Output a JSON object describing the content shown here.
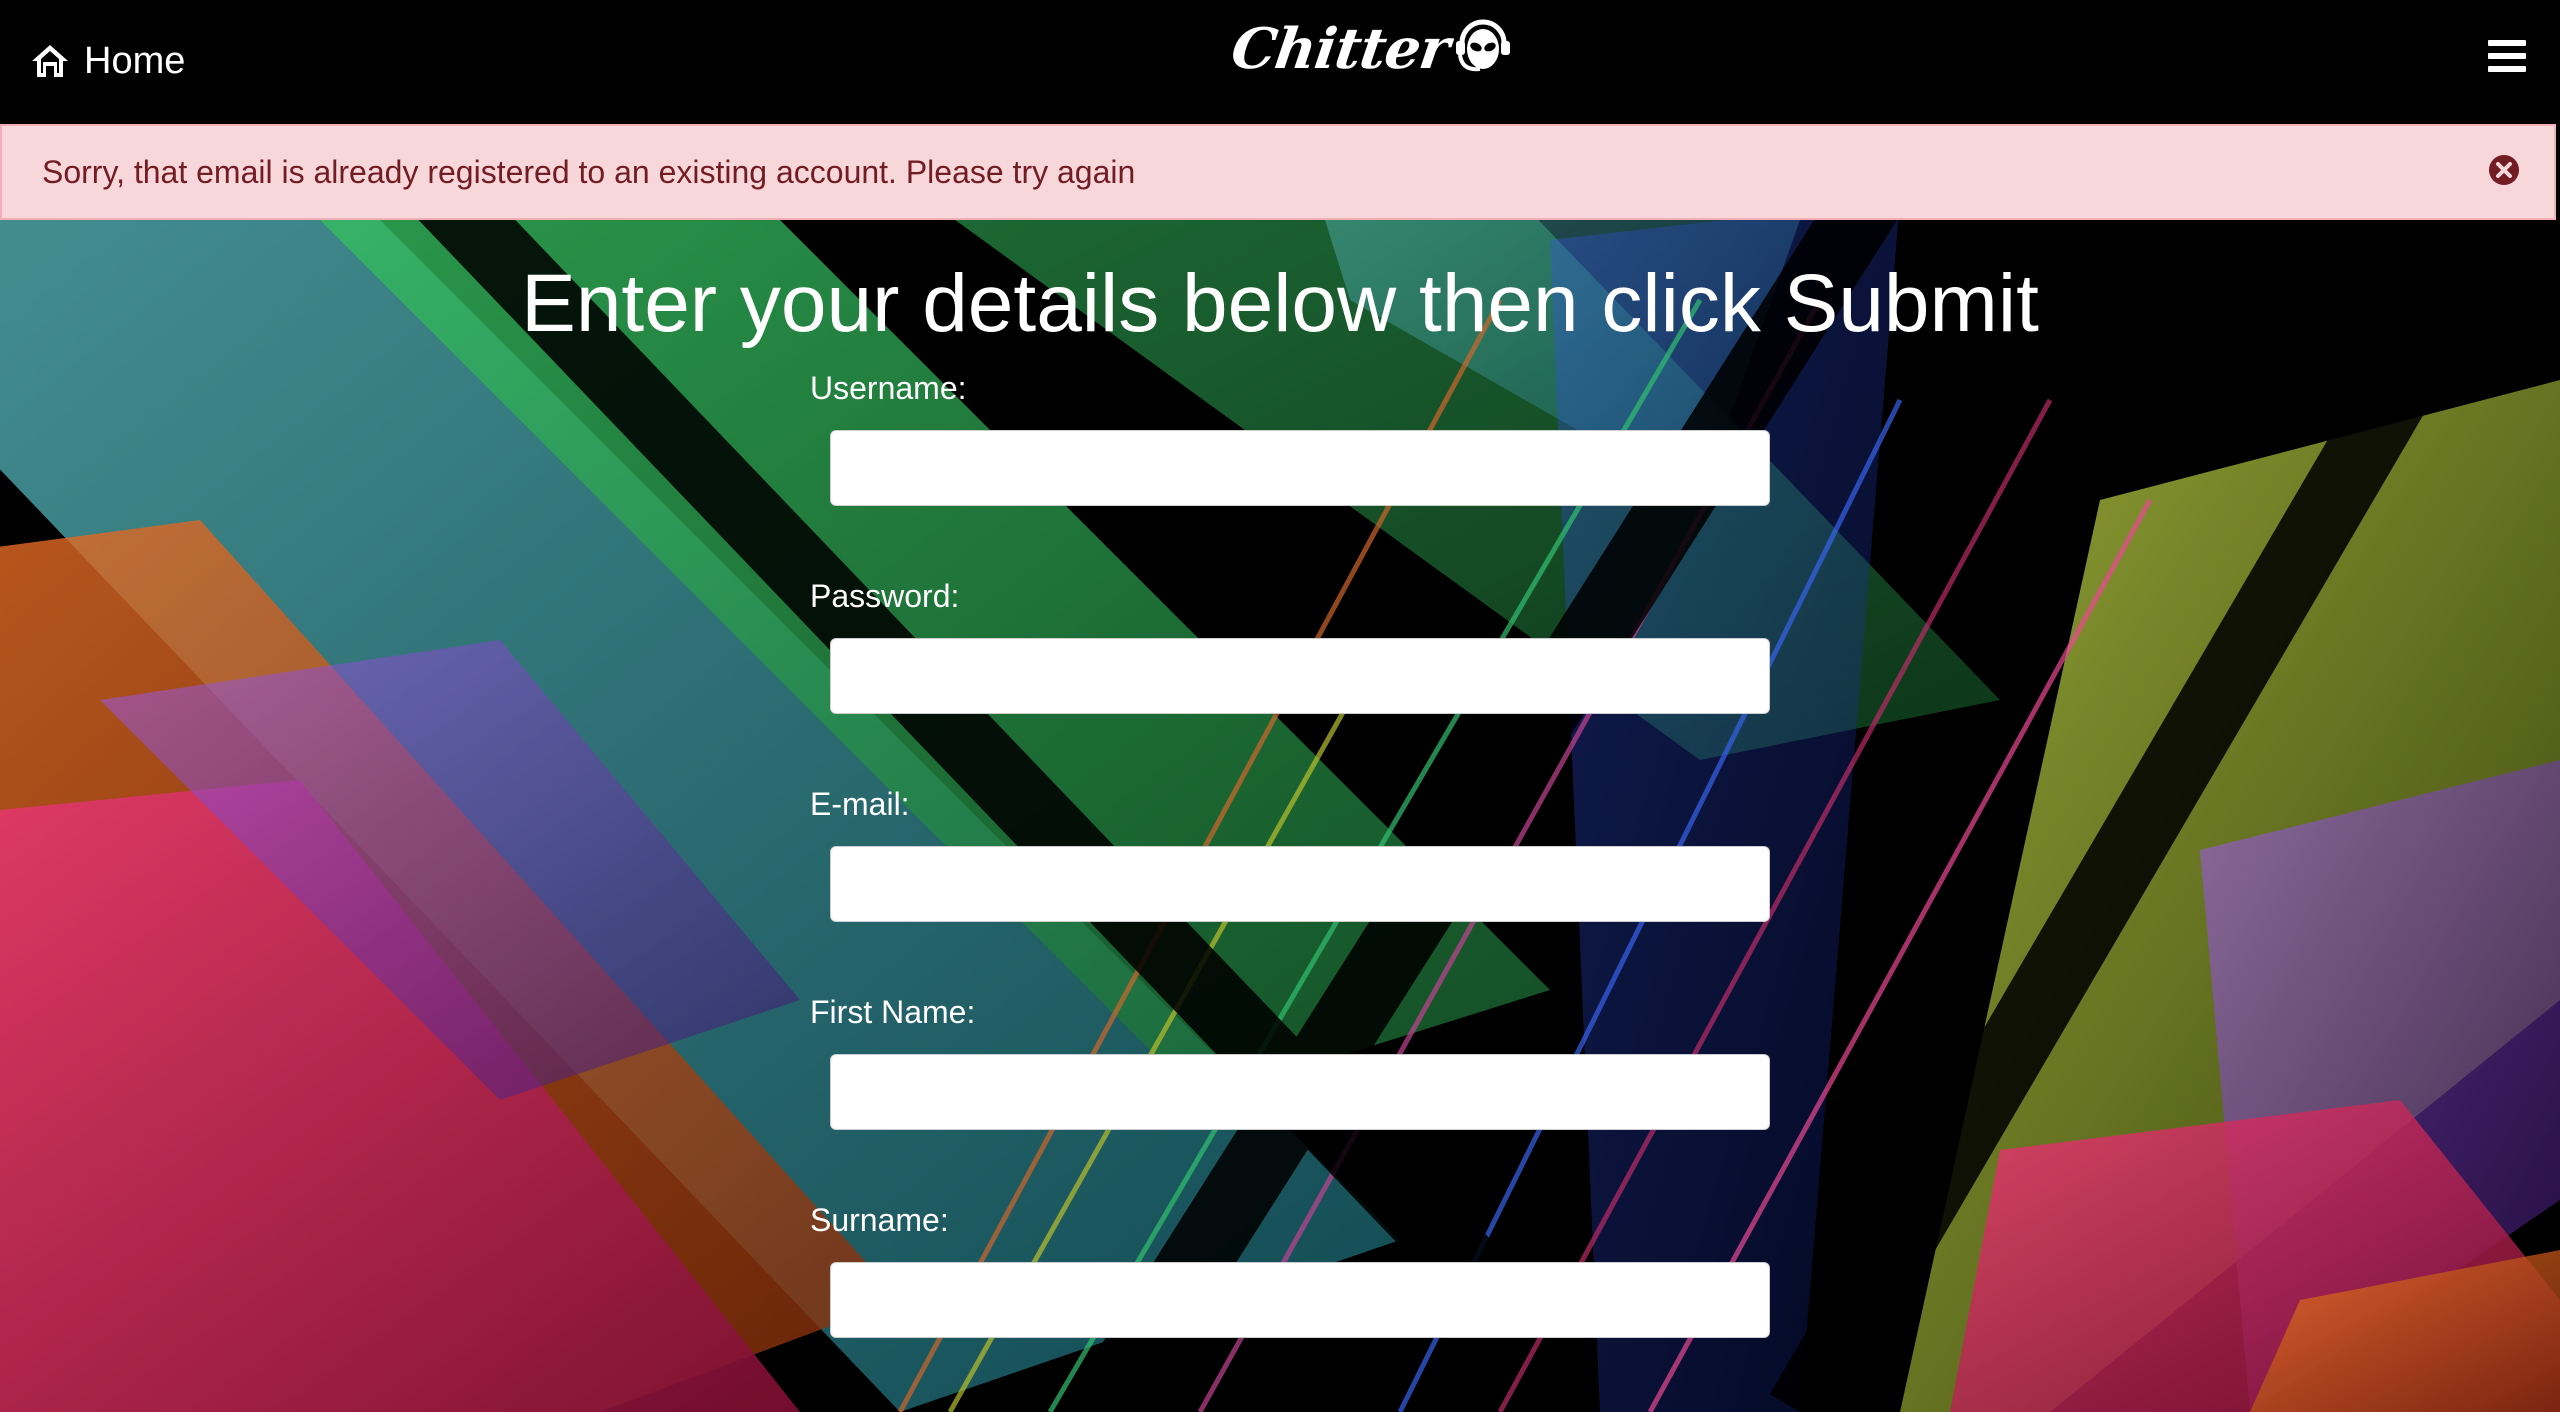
{
  "navbar": {
    "home_label": "Home",
    "brand_name": "Chitter"
  },
  "alert": {
    "message": "Sorry, that email is already registered to an existing account. Please try again",
    "type": "danger",
    "background_color": "#f8d7da",
    "text_color": "#721c24"
  },
  "form": {
    "title": "Enter your details below then click Submit",
    "fields": [
      {
        "label": "Username:",
        "value": "",
        "placeholder": ""
      },
      {
        "label": "Password:",
        "value": "",
        "placeholder": ""
      },
      {
        "label": "E-mail:",
        "value": "",
        "placeholder": ""
      },
      {
        "label": "First Name:",
        "value": "",
        "placeholder": ""
      },
      {
        "label": "Surname:",
        "value": "",
        "placeholder": ""
      }
    ]
  },
  "icons": {
    "home": "home-icon",
    "brand": "alien-headset-icon",
    "menu": "hamburger-menu-icon",
    "close": "close-circle-icon"
  }
}
